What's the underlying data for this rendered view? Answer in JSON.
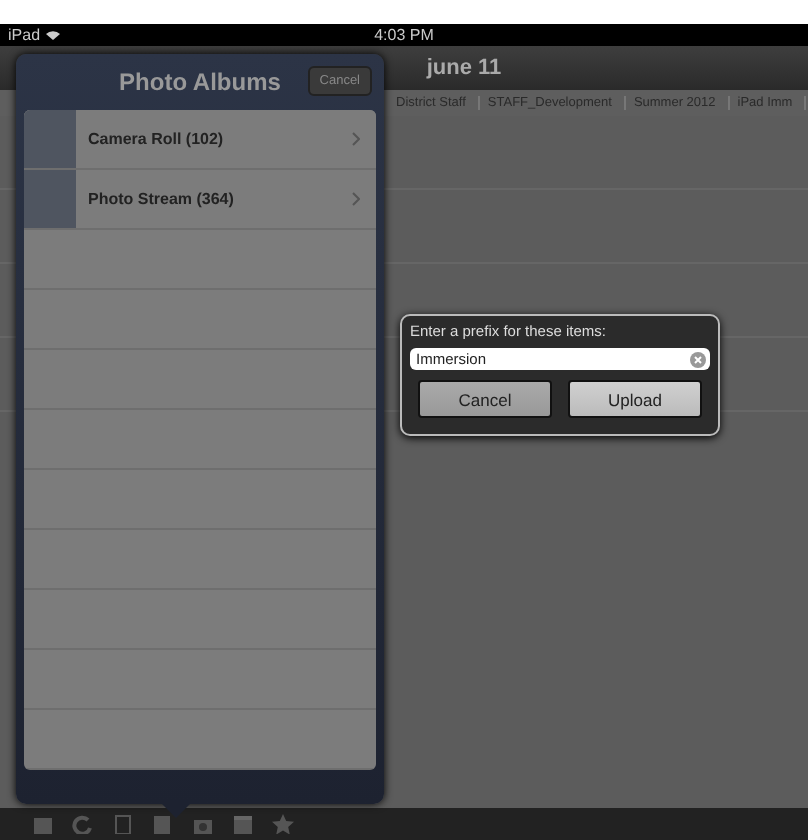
{
  "status_bar": {
    "device": "iPad",
    "time": "4:03 PM"
  },
  "nav_bar": {
    "title": "june 11"
  },
  "breadcrumbs": [
    "District Staff",
    "STAFF_Development",
    "Summer 2012",
    "iPad Imm"
  ],
  "popover": {
    "title": "Photo Albums",
    "cancel": "Cancel",
    "albums": [
      {
        "name": "Camera Roll (102)"
      },
      {
        "name": "Photo Stream (364)"
      }
    ]
  },
  "dialog": {
    "prompt": "Enter a prefix for these items:",
    "field": {
      "value": "Immersion"
    },
    "buttons": [
      "Cancel",
      "Upload"
    ]
  }
}
